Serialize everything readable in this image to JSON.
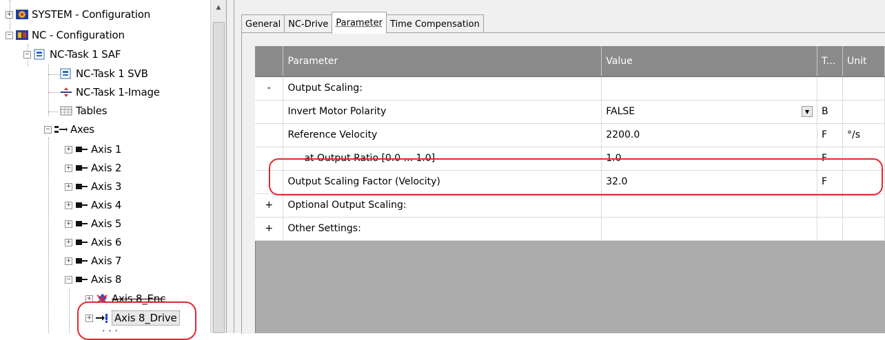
{
  "tree": {
    "system": "SYSTEM - Configuration",
    "nc": "NC - Configuration",
    "nc_task_saf": "NC-Task 1 SAF",
    "nc_task_svb": "NC-Task 1 SVB",
    "nc_task_image": "NC-Task 1-Image",
    "tables": "Tables",
    "axes": "Axes",
    "axis1": "Axis 1",
    "axis2": "Axis 2",
    "axis3": "Axis 3",
    "axis4": "Axis 4",
    "axis5": "Axis 5",
    "axis6": "Axis 6",
    "axis7": "Axis 7",
    "axis8": "Axis 8",
    "axis8_enc": "Axis 8_Enc",
    "axis8_drive": "Axis 8_Drive"
  },
  "tabs": [
    "General",
    "NC-Drive",
    "Parameter",
    "Time Compensation"
  ],
  "grid": {
    "headers": [
      "",
      "Parameter",
      "Value",
      "T...",
      "Unit"
    ],
    "rows": [
      {
        "toggle": "-",
        "param": "Output Scaling:",
        "value": "",
        "type": "",
        "unit": ""
      },
      {
        "toggle": "",
        "param": "Invert Motor Polarity",
        "value": "FALSE",
        "type": "B",
        "unit": ""
      },
      {
        "toggle": "",
        "param": "Reference Velocity",
        "value": "2200.0",
        "type": "F",
        "unit": "°/s"
      },
      {
        "toggle": "",
        "param": "at Output Ratio [0.0 ... 1.0]",
        "value": "1.0",
        "type": "F",
        "unit": ""
      },
      {
        "toggle": "",
        "param": "Output Scaling Factor (Velocity)",
        "value": "32.0",
        "type": "F",
        "unit": ""
      },
      {
        "toggle": "+",
        "param": "Optional Output Scaling:",
        "value": "",
        "type": "",
        "unit": ""
      },
      {
        "toggle": "+",
        "param": "Other Settings:",
        "value": "",
        "type": "",
        "unit": ""
      }
    ]
  },
  "colors": {
    "highlight": "#e2282d",
    "header_bg": "#8a8a8a",
    "grid_empty": "#ababab"
  }
}
